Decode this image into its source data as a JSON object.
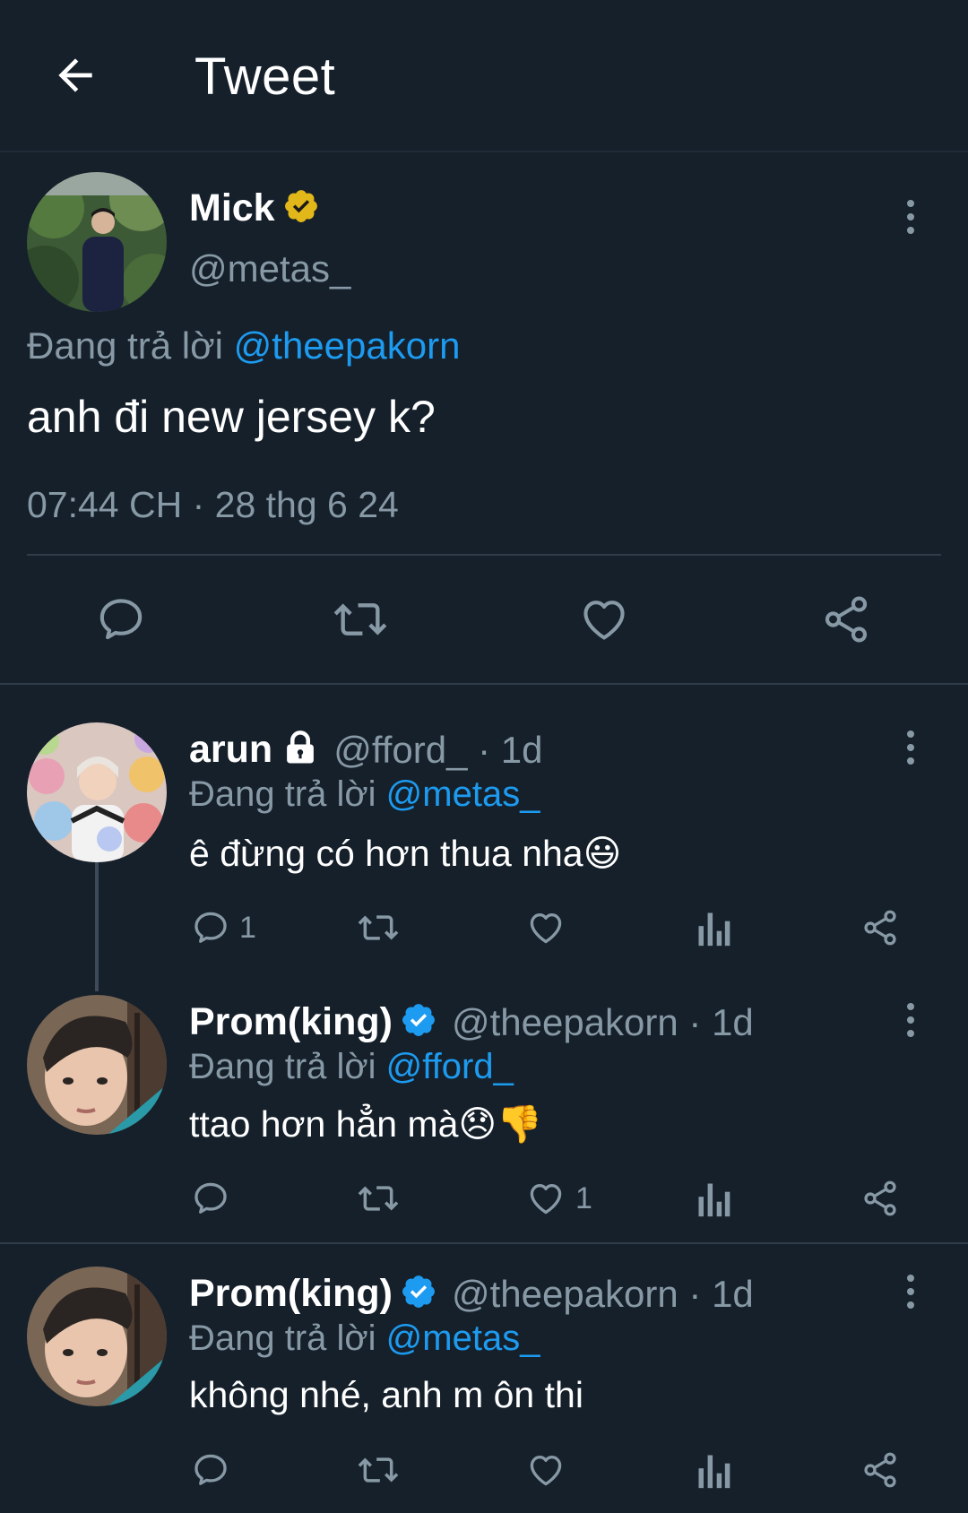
{
  "header": {
    "title": "Tweet"
  },
  "main_tweet": {
    "name": "Mick",
    "handle": "@metas_",
    "replying_prefix": "Đang trả lời",
    "replying_to": "@theepakorn",
    "text": "anh đi new jersey k?",
    "timestamp": "07:44 CH · 28 thg 6 24"
  },
  "replies": [
    {
      "name": "arun",
      "handle_time": "@fford_ · 1d",
      "replying_prefix": "Đang trả lời",
      "replying_to": "@metas_",
      "text": "ê đừng có hơn thua nha😃",
      "reply_count": "1",
      "like_count": ""
    },
    {
      "name": "Prom(king)",
      "handle_time": "@theepakorn · 1d",
      "replying_prefix": "Đang trả lời",
      "replying_to": "@fford_",
      "text": "ttao hơn hẳn mà😞👎",
      "reply_count": "",
      "like_count": "1"
    },
    {
      "name": "Prom(king)",
      "handle_time": "@theepakorn · 1d",
      "replying_prefix": "Đang trả lời",
      "replying_to": "@metas_",
      "text": "không nhé, anh m ôn thi",
      "reply_count": "",
      "like_count": ""
    }
  ],
  "colors": {
    "background": "#15202b",
    "text": "#ffffff",
    "muted": "#8899a6",
    "link": "#1d9bf0",
    "verified_blue": "#1d9bf0",
    "verified_gold": "#e2b719"
  },
  "icons": {
    "back": "arrow-left-icon",
    "verified_gold": "verified-gold-badge-icon",
    "verified_blue": "verified-blue-badge-icon",
    "lock": "lock-icon",
    "more": "more-vertical-icon",
    "reply": "reply-icon",
    "retweet": "retweet-icon",
    "like": "heart-icon",
    "views": "analytics-icon",
    "share": "share-icon"
  }
}
